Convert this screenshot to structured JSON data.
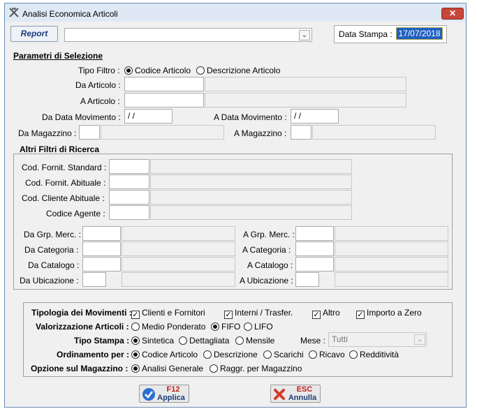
{
  "window": {
    "title": "Analisi Economica Articoli",
    "close": "✕"
  },
  "toolbar": {
    "report": "Report",
    "data_stampa_label": "Data Stampa :",
    "data_stampa": "17/07/2018"
  },
  "sel": {
    "header": "Parametri di Selezione",
    "tipo_filtro": "Tipo Filtro :",
    "opt_codice": "Codice Articolo",
    "opt_descr": "Descrizione Articolo",
    "da_articolo": "Da Articolo :",
    "a_articolo": "A Articolo :",
    "da_data_mov": "Da Data Movimento :",
    "da_data_val": " / /",
    "a_data_mov": "A Data Movimento :",
    "a_data_val": " / /",
    "da_magazzino": "Da Magazzino :",
    "a_magazzino": "A  Magazzino :"
  },
  "altri": {
    "header": "Altri Filtri di Ricerca",
    "forn_std": "Cod. Fornit. Standard :",
    "forn_abit": "Cod. Fornit. Abituale :",
    "cli_abit": "Cod. Cliente Abituale :",
    "agente": "Codice Agente :",
    "da_grp": "Da Grp. Merc. :",
    "a_grp": "A Grp. Merc. :",
    "da_cat": "Da Categoria :",
    "a_cat": "A  Categoria :",
    "da_catalogo": "Da Catalogo :",
    "a_catalogo": "A Catalogo :",
    "da_ubic": "Da Ubicazione :",
    "a_ubic": "A Ubicazione :"
  },
  "opz": {
    "tipologia": "Tipologia dei Movimenti :",
    "clienti": "Clienti e Fornitori",
    "interni": "Interni / Trasfer.",
    "altro": "Altro",
    "importo_zero": "Importo a Zero",
    "valorizzazione": "Valorizzazione Articoli :",
    "medio": "Medio Ponderato",
    "fifo": "FIFO",
    "lifo": "LIFO",
    "tipo_stampa": "Tipo Stampa :",
    "sintetica": "Sintetica",
    "dettagliata": "Dettagliata",
    "mensile": "Mensile",
    "mese_label": "Mese :",
    "mese_value": "Tutti",
    "ordinamento": "Ordinamento per :",
    "ord_codice": "Codice Articolo",
    "ord_descr": "Descrizione",
    "ord_scarichi": "Scarichi",
    "ord_ricavo": "Ricavo",
    "ord_redd": "Redditività",
    "opzione_mag": "Opzione sul Magazzino :",
    "analisi": "Analisi Generale",
    "raggr": "Raggr. per Magazzino"
  },
  "buttons": {
    "f12_key": "F12",
    "applica": "Applica",
    "esc_key": "ESC",
    "annulla": "Annulla"
  }
}
